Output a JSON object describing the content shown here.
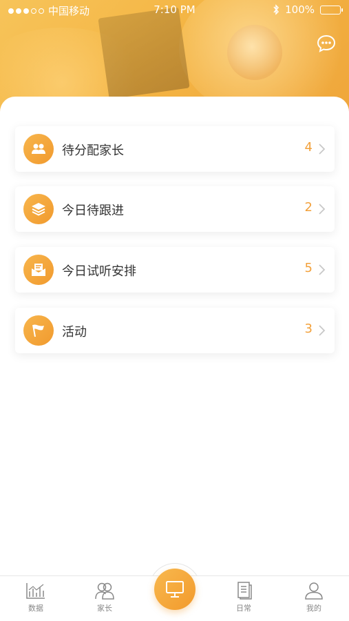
{
  "status_bar": {
    "carrier": "中国移动",
    "time": "7:10 PM",
    "battery": "100%"
  },
  "header": {
    "message_icon": "chat-bubble-icon"
  },
  "menu": {
    "items": [
      {
        "label": "待分配家长",
        "count": "4",
        "icon": "people-icon"
      },
      {
        "label": "今日待跟进",
        "count": "2",
        "icon": "layers-icon"
      },
      {
        "label": "今日试听安排",
        "count": "5",
        "icon": "envelope-icon"
      },
      {
        "label": "活动",
        "count": "3",
        "icon": "flag-icon"
      }
    ]
  },
  "tabbar": {
    "tabs": [
      {
        "label": "数据",
        "icon": "chart-icon"
      },
      {
        "label": "家长",
        "icon": "parents-icon"
      },
      {
        "label": "",
        "icon": "monitor-icon"
      },
      {
        "label": "日常",
        "icon": "document-icon"
      },
      {
        "label": "我的",
        "icon": "profile-icon"
      }
    ]
  },
  "colors": {
    "accent": "#f2a03a",
    "text": "#333333",
    "tab_text": "#888888"
  }
}
